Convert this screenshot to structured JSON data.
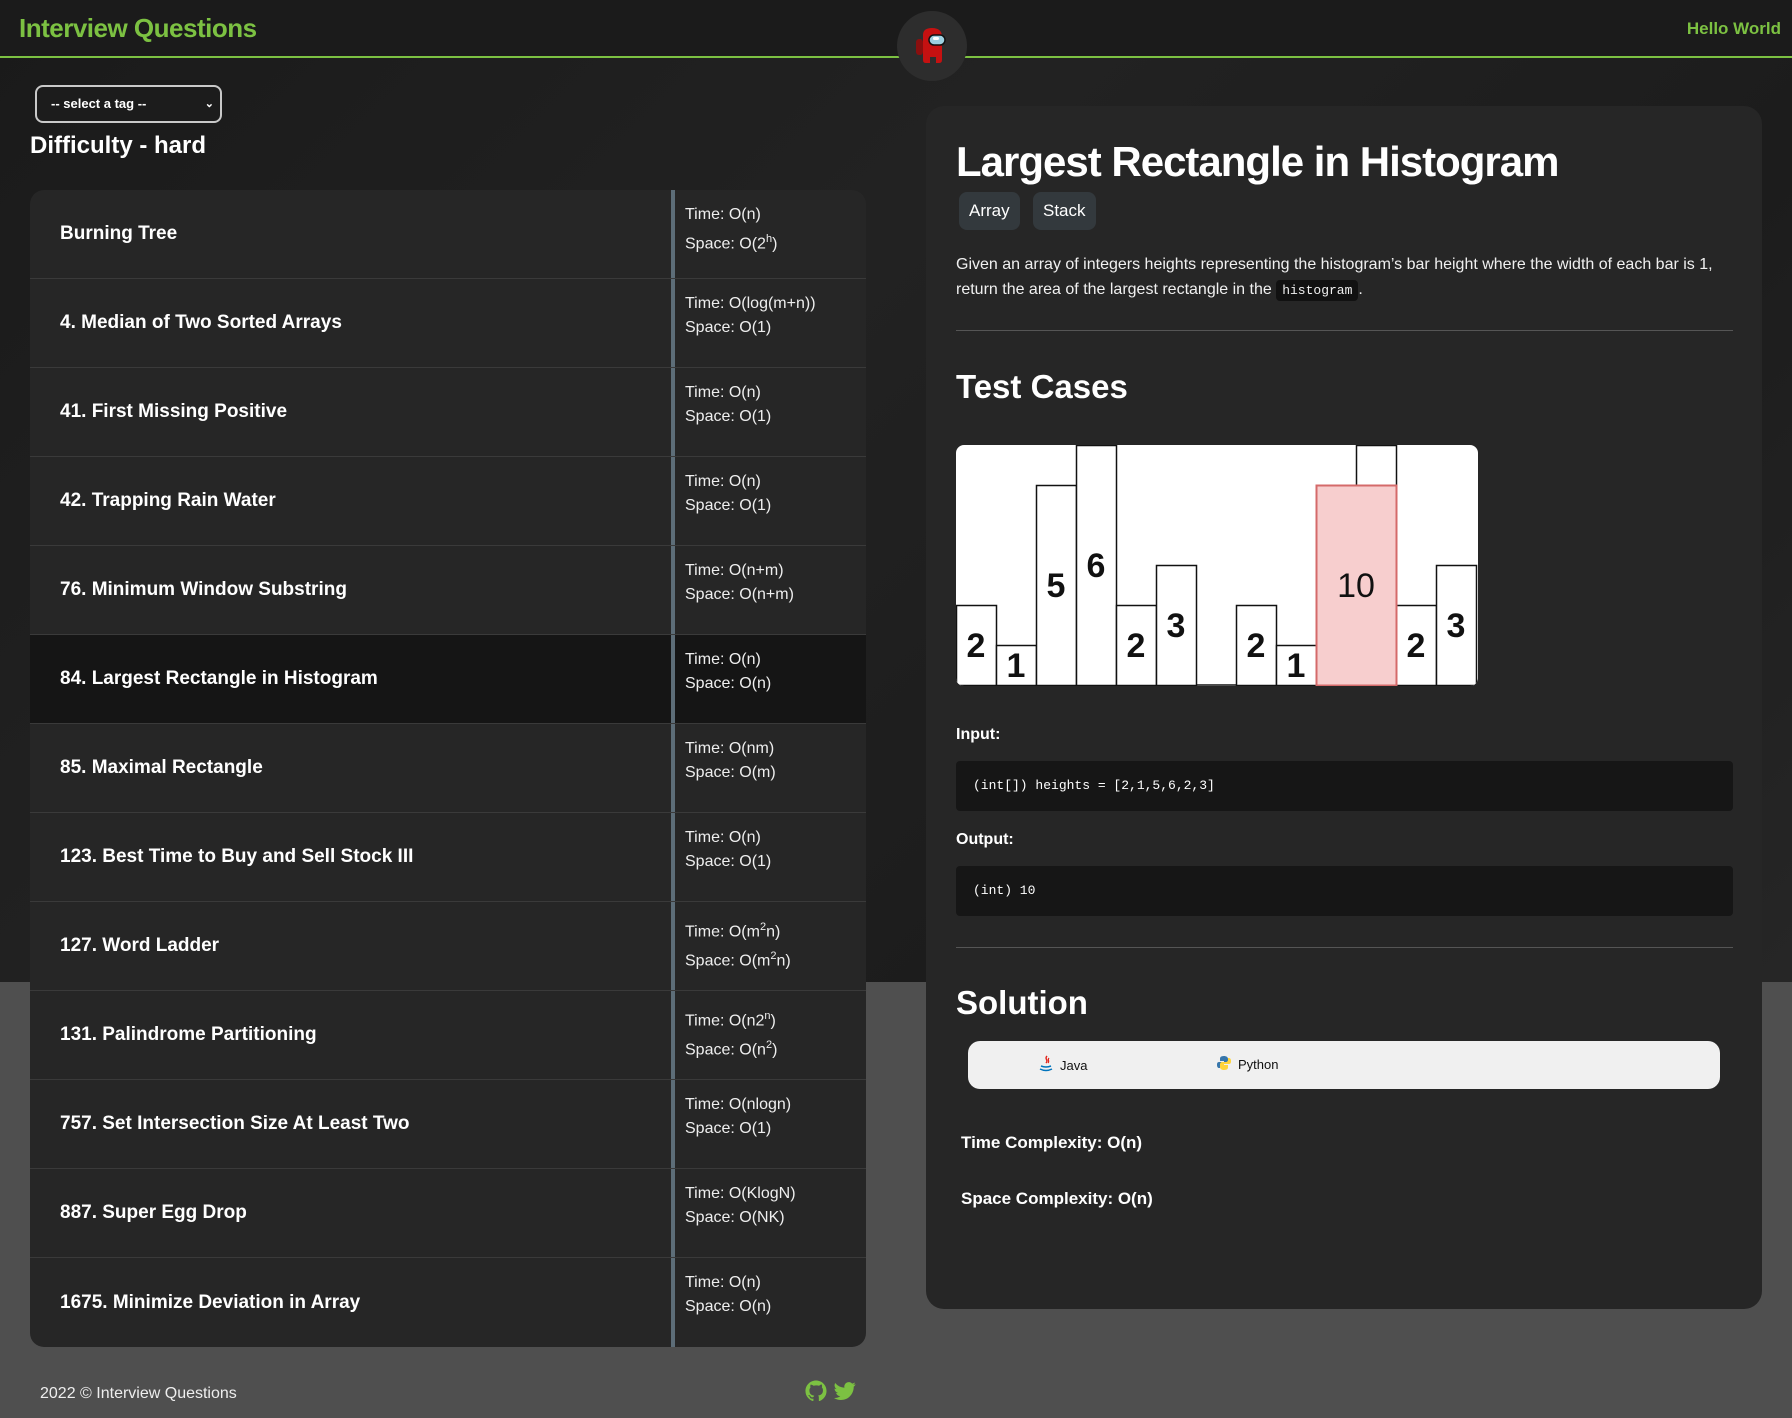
{
  "header": {
    "brand": "Interview Questions",
    "greeting": "Hello World",
    "logo_icon": "crewmate-icon"
  },
  "filter": {
    "tag_select_value": "-- select a tag --",
    "difficulty_title": "Difficulty - hard"
  },
  "questions": [
    {
      "title": "Burning Tree",
      "time": "Time: O(n)",
      "space": "Space: O(2^h)"
    },
    {
      "title": "4. Median of Two Sorted Arrays",
      "time": "Time: O(log(m+n))",
      "space": "Space: O(1)"
    },
    {
      "title": "41. First Missing Positive",
      "time": "Time: O(n)",
      "space": "Space: O(1)"
    },
    {
      "title": "42. Trapping Rain Water",
      "time": "Time: O(n)",
      "space": "Space: O(1)"
    },
    {
      "title": "76. Minimum Window Substring",
      "time": "Time: O(n+m)",
      "space": "Space: O(n+m)"
    },
    {
      "title": "84. Largest Rectangle in Histogram",
      "time": "Time: O(n)",
      "space": "Space: O(n)"
    },
    {
      "title": "85. Maximal Rectangle",
      "time": "Time: O(nm)",
      "space": "Space: O(m)"
    },
    {
      "title": "123. Best Time to Buy and Sell Stock III",
      "time": "Time: O(n)",
      "space": "Space: O(1)"
    },
    {
      "title": "127. Word Ladder",
      "time": "Time: O(m^2n)",
      "space": "Space: O(m^2n)"
    },
    {
      "title": "131. Palindrome Partitioning",
      "time": "Time: O(n2^n)",
      "space": "Space: O(n^2)"
    },
    {
      "title": "757. Set Intersection Size At Least Two",
      "time": "Time: O(nlogn)",
      "space": "Space: O(1)"
    },
    {
      "title": "887. Super Egg Drop",
      "time": "Time: O(KlogN)",
      "space": "Space: O(NK)"
    },
    {
      "title": "1675. Minimize Deviation in Array",
      "time": "Time: O(n)",
      "space": "Space: O(n)"
    }
  ],
  "footer": {
    "copyright": "2022 © Interview Questions",
    "icons": [
      "github-icon",
      "twitter-icon"
    ]
  },
  "detail": {
    "title": "Largest Rectangle in Histogram",
    "tags": [
      "Array",
      "Stack"
    ],
    "description_before": "Given an array of integers heights representing the histogram’s bar height where the width of each bar is 1, return the area of the largest rectangle in the",
    "description_code": "histogram",
    "description_after": ".",
    "test_cases_title": "Test Cases",
    "histogram": {
      "groups": [
        {
          "bars": [
            2,
            1,
            5,
            6,
            2,
            3
          ],
          "highlight": null
        },
        {
          "bars": [
            2,
            1,
            5,
            6,
            2,
            3
          ],
          "highlight": [
            2,
            3
          ],
          "highlight_area": "10"
        }
      ],
      "highlight_color": "#f7cece",
      "highlight_border": "#d46a6a"
    },
    "input_label": "Input:",
    "input_code": "(int[]) heights = [2,1,5,6,2,3]",
    "output_label": "Output:",
    "output_code": "(int) 10",
    "solution_title": "Solution",
    "languages": [
      {
        "label": "Java",
        "icon": "java-icon"
      },
      {
        "label": "Python",
        "icon": "python-icon"
      }
    ],
    "time_complexity": "Time Complexity: O(n)",
    "space_complexity": "Space Complexity: O(n)"
  },
  "colors": {
    "accent": "#7cc142",
    "selected_row": "#151515",
    "panel": "#262626"
  }
}
